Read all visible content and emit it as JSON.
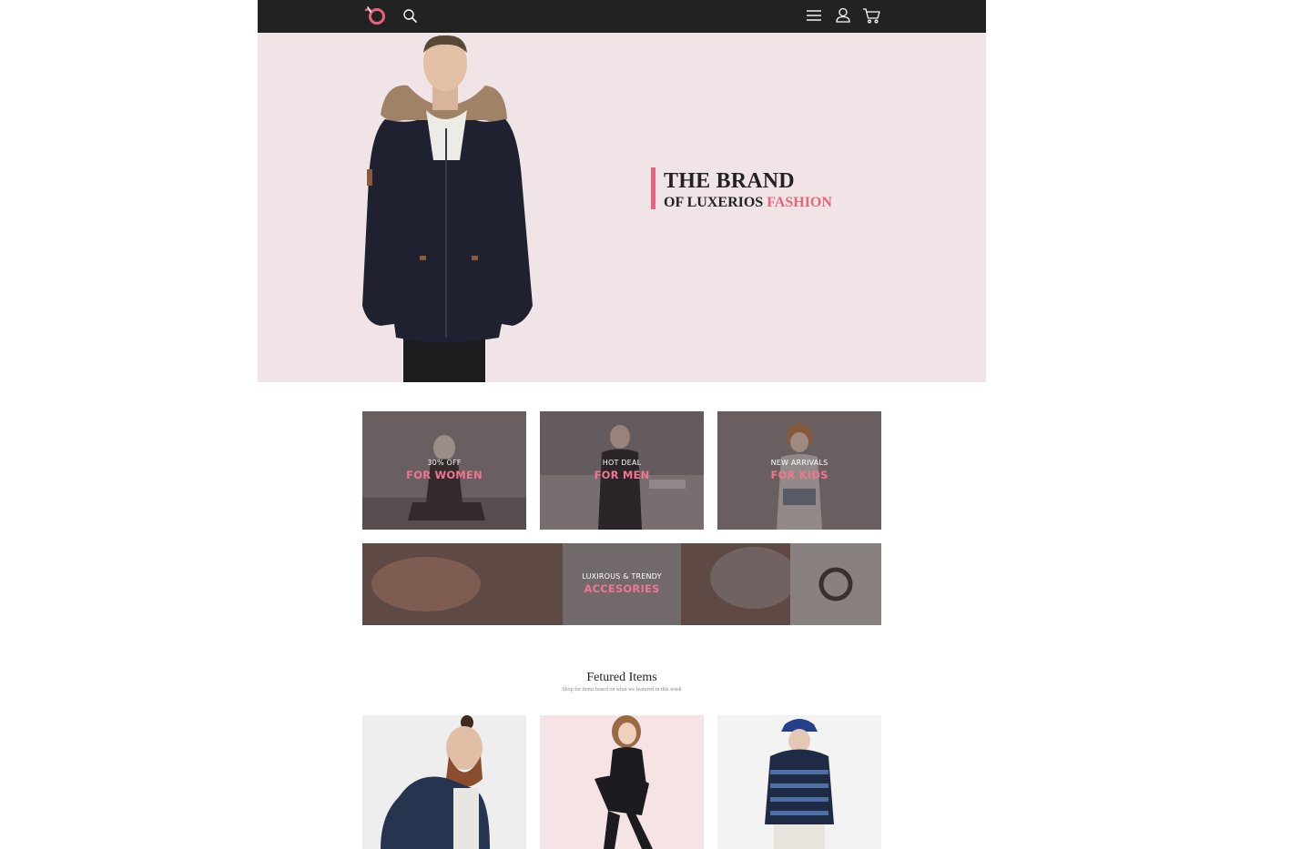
{
  "navbar": {
    "logo_icon": "brand-logo-icon",
    "search_icon": "search-icon",
    "menu_icon": "hamburger-menu-icon",
    "user_icon": "user-icon",
    "cart_icon": "cart-icon",
    "background_color": "#222222"
  },
  "hero": {
    "title": "THE BRAND",
    "subtitle_prefix": "OF LUXERIOS ",
    "subtitle_accent": "FASHION",
    "background_color": "#f0e4e6",
    "accent_color": "#e8637c"
  },
  "promos": {
    "women": {
      "small": "30% OFF",
      "big": "FOR WOMEN"
    },
    "men": {
      "small": "HOT DEAL",
      "big": "FOR MEN"
    },
    "kids": {
      "small": "NEW ARRIVALS",
      "big": "FOR KIDS"
    },
    "accessories": {
      "small": "LUXIROUS & TRENDY",
      "big": "ACCESORIES"
    }
  },
  "featured": {
    "title": "Fetured Items",
    "subtitle": "Shop for items based on what we featured in this week"
  }
}
